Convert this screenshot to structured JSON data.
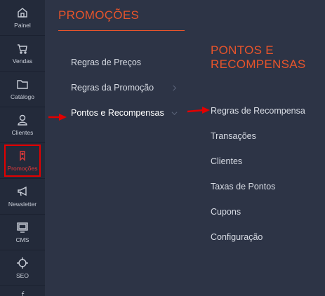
{
  "rail": {
    "items": [
      {
        "label": "Painel",
        "icon": "home-icon"
      },
      {
        "label": "Vendas",
        "icon": "cart-icon"
      },
      {
        "label": "Catálogo",
        "icon": "folder-icon"
      },
      {
        "label": "Clientes",
        "icon": "user-icon"
      },
      {
        "label": "Promoções",
        "icon": "tag-icon"
      },
      {
        "label": "Newsletter",
        "icon": "megaphone-icon"
      },
      {
        "label": "CMS",
        "icon": "monitor-icon"
      },
      {
        "label": "SEO",
        "icon": "target-icon"
      }
    ],
    "active_color": "#e03a3a"
  },
  "panel": {
    "title": "PROMOÇÕES",
    "items": [
      {
        "label": "Regras de Preços"
      },
      {
        "label": "Regras da Promoção"
      },
      {
        "label": "Pontos e Recompensas"
      }
    ]
  },
  "submenu": {
    "title": "PONTOS E RECOMPENSAS",
    "items": [
      {
        "label": "Regras de Recompensa"
      },
      {
        "label": "Transações"
      },
      {
        "label": "Clientes"
      },
      {
        "label": "Taxas de Pontos"
      },
      {
        "label": "Cupons"
      },
      {
        "label": "Configuração"
      }
    ]
  },
  "colors": {
    "accent": "#e8542b",
    "highlight": "#e30000",
    "sidebar": "#232a3a",
    "panel": "#2d3446"
  }
}
